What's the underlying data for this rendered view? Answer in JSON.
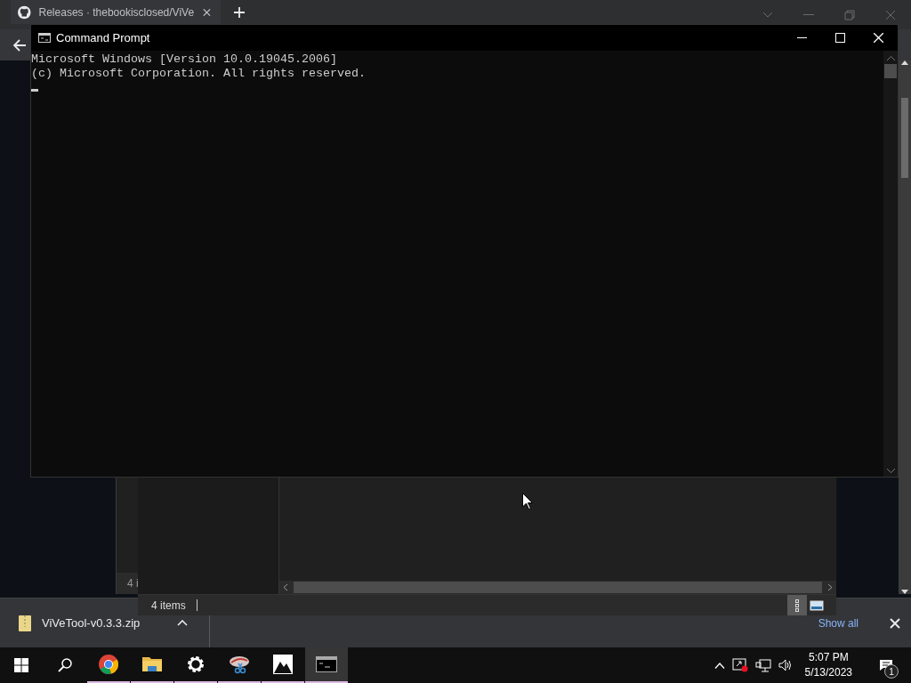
{
  "browser": {
    "tabs": [
      {
        "title": "Releases · thebookisclosed/ViVe",
        "selected": true
      }
    ]
  },
  "explorer_back": {
    "status_text": "4 i"
  },
  "explorer": {
    "status_text": "4 items",
    "view_buttons": [
      {
        "kind": "details",
        "selected": true
      },
      {
        "kind": "thumbnails",
        "selected": false
      }
    ]
  },
  "command_prompt": {
    "title": "Command Prompt",
    "lines": [
      "Microsoft Windows [Version 10.0.19045.2006]",
      "(c) Microsoft Corporation. All rights reserved."
    ]
  },
  "download_bar": {
    "file_name": "ViVeTool-v0.3.3.zip",
    "show_all": "Show all"
  },
  "taskbar": {
    "apps": [
      {
        "kind": "chrome",
        "running": true,
        "selected": false
      },
      {
        "kind": "folder",
        "running": true,
        "selected": false
      },
      {
        "kind": "settings",
        "running": true,
        "selected": false
      },
      {
        "kind": "snip",
        "running": true,
        "selected": false
      },
      {
        "kind": "photos",
        "running": true,
        "selected": false
      },
      {
        "kind": "terminal",
        "running": true,
        "selected": true
      }
    ],
    "time": "5:07 PM",
    "date": "5/13/2023",
    "notification_count": "1"
  }
}
